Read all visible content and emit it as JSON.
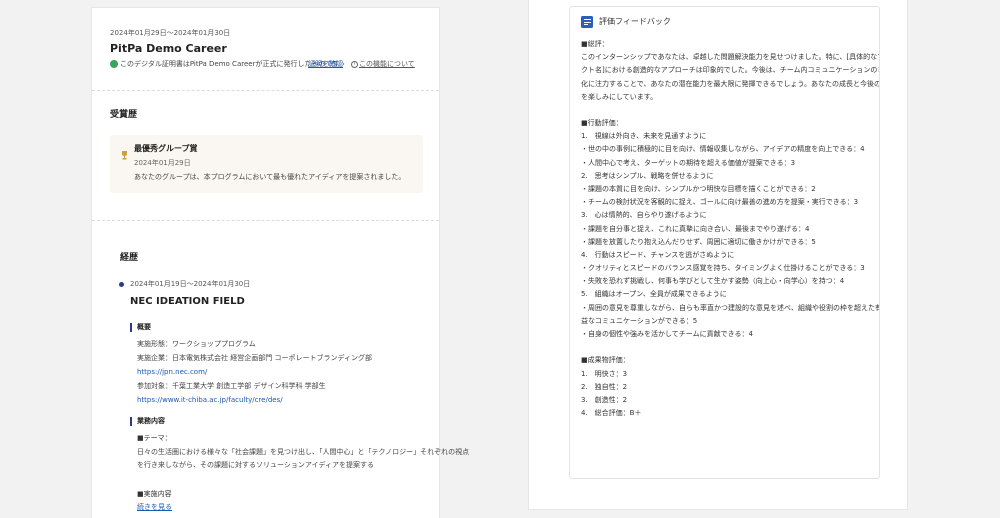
{
  "certificate": {
    "period": "2024年01月29日～2024年01月30日",
    "title": "PitPa Demo Career",
    "verify_text": "このデジタル証明書はPitPa Demo Careerが正式に発行したものです",
    "verify_link": "証明を確認",
    "about_link": "この機能について"
  },
  "awards": {
    "heading": "受賞歴",
    "items": [
      {
        "name": "最優秀グループ賞",
        "date": "2024年01月29日",
        "description": "あなたのグループは、本プログラムにおいて最も優れたアイディアを提案されました。"
      }
    ]
  },
  "career": {
    "heading": "経歴",
    "period": "2024年01月19日～2024年01月30日",
    "title": "NEC IDEATION FIELD",
    "overview_heading": "概要",
    "overview_lines": [
      "実施形態：ワークショッププログラム",
      "実施企業：日本電気株式会社 経営企画部門 コーポレートブランディング部"
    ],
    "overview_link1": "https://jpn.nec.com/",
    "overview_line3": "参加対象：千葉工業大学 創造工学部 デザイン科学科 学部生",
    "overview_link2": "https://www.it-chiba.ac.jp/faculty/cre/des/",
    "work_heading": "業務内容",
    "theme_heading": "■テーマ：",
    "theme_lines": [
      "日々の生活圏における様々な「社会課題」を見つけ出し、「人間中心」と「テクノロジー」それぞれの視点",
      "を行き来しながら、その課題に対するソリューションアイディアを提案する"
    ],
    "impl_heading": "■実施内容",
    "read_more": "続きを見る"
  },
  "feedback": {
    "title": "評価フィードバック",
    "icon": "document-icon",
    "lines": [
      "■総評：",
      "このインターンシップであなたは、卓越した問題解決能力を見せつけました。特に、[具体的なプロジェ",
      "クト名]における創造的なアプローチは印象的でした。今後は、チーム内コミュニケーションのさらなる強",
      "化に注力することで、あなたの潜在能力を最大限に発揮できるでしょう。あなたの成長と今後の成功",
      "を楽しみにしています。",
      "",
      "■行動評価：",
      "1.　視線は外向き、未来を見通すように",
      "・世の中の事例に積極的に目を向け、情報収集しながら、アイデアの精度を向上できる：4",
      "・人間中心で考え、ターゲットの期待を超える価値が提案できる：3",
      "2.　思考はシンプル、戦略を併せるように",
      "・課題の本質に目を向け、シンプルかつ明快な目標を描くことができる：2",
      "・チームの検討状況を客観的に捉え、ゴールに向け最善の進め方を提案・実行できる：3",
      "3.　心は情熱的、自らやり遂げるように",
      "・課題を自分事と捉え、これに真摯に向き合い、最後までやり遂げる：4",
      "・課題を放置したり抱え込んだりせず、周囲に適切に働きかけができる：5",
      "4.　行動はスピード、チャンスを逃がさぬように",
      "・クオリティとスピードのバランス感覚を持ち、タイミングよく仕掛けることができる：3",
      "・失敗を恐れず挑戦し、何事も学びとして生かす姿勢（向上心・向学心）を持つ：4",
      "5.　組織はオープン、全員が成果できるように",
      "・周囲の意見を尊重しながら、自らも率直かつ建設的な意見を述べ、組織や役割の枠を超えた有",
      "益なコミュニケーションができる：5",
      "・自身の個性や強みを活かしてチームに貢献できる：4",
      "",
      "■成果物評価：",
      "1.　明快さ：3",
      "2.　独自性：2",
      "3.　創造性：2",
      "4.　総合評価：B＋"
    ]
  }
}
